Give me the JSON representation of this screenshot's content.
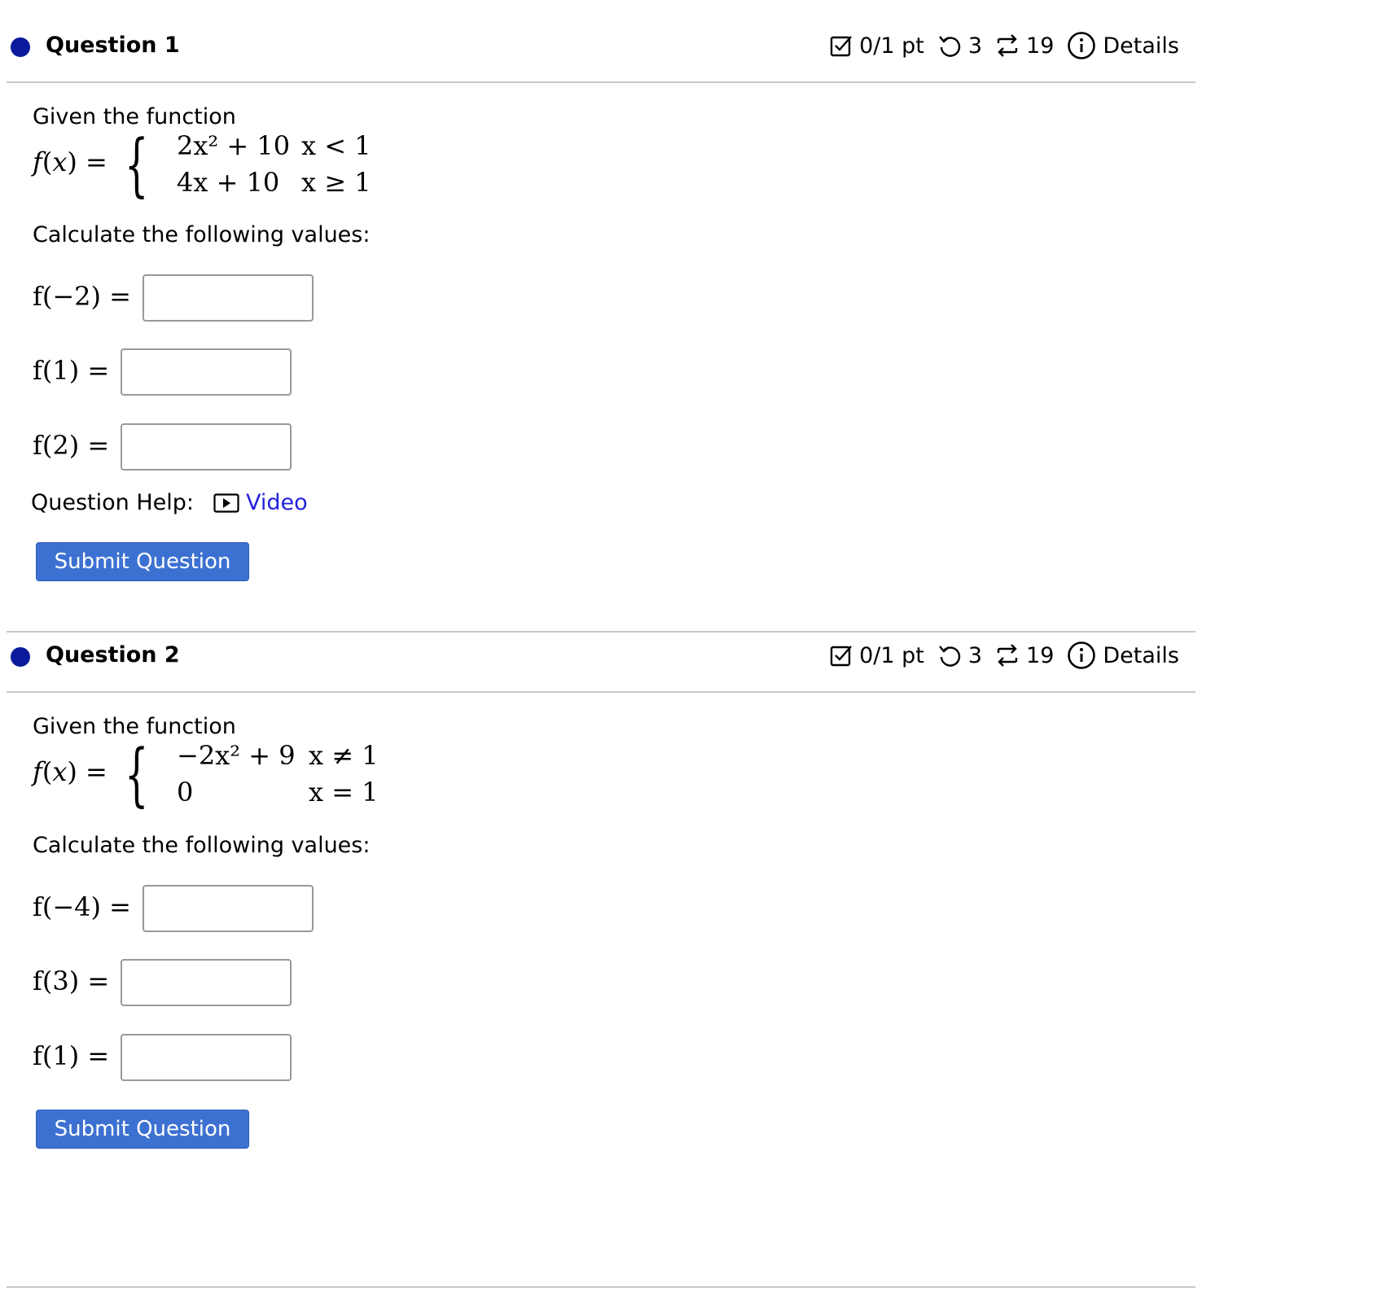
{
  "questions": [
    {
      "title": "Question 1",
      "meta": {
        "points": "0/1 pt",
        "retries": "3",
        "attempts": "19",
        "details": "Details"
      },
      "intro": "Given the function",
      "function": {
        "lhs": "f(x) =",
        "pieces": [
          {
            "expr": "2x² + 10",
            "cond": "x < 1"
          },
          {
            "expr": "4x + 10",
            "cond": "x ≥ 1"
          }
        ]
      },
      "prompt": "Calculate the following values:",
      "answers": [
        {
          "label": "f(−2) =",
          "value": ""
        },
        {
          "label": "f(1) =",
          "value": ""
        },
        {
          "label": "f(2) =",
          "value": ""
        }
      ],
      "help": {
        "label": "Question Help:",
        "link": "Video",
        "icon": "video-play-icon"
      },
      "submit_label": "Submit Question"
    },
    {
      "title": "Question 2",
      "meta": {
        "points": "0/1 pt",
        "retries": "3",
        "attempts": "19",
        "details": "Details"
      },
      "intro": "Given the function",
      "function": {
        "lhs": "f(x) =",
        "pieces": [
          {
            "expr": "−2x² + 9",
            "cond": "x ≠ 1"
          },
          {
            "expr": "0",
            "cond": "x = 1"
          }
        ]
      },
      "prompt": "Calculate the following values:",
      "answers": [
        {
          "label": "f(−4) =",
          "value": ""
        },
        {
          "label": "f(3) =",
          "value": ""
        },
        {
          "label": "f(1) =",
          "value": ""
        }
      ],
      "submit_label": "Submit Question"
    }
  ],
  "colors": {
    "status_dot": "#0a1a9c",
    "link": "#2222dd",
    "button": "#3d71d1",
    "divider": "#c8c8c8"
  },
  "icons": {
    "points": "checkbox-icon",
    "retries": "retry-icon",
    "attempts": "attempts-icon",
    "details": "info-icon"
  }
}
